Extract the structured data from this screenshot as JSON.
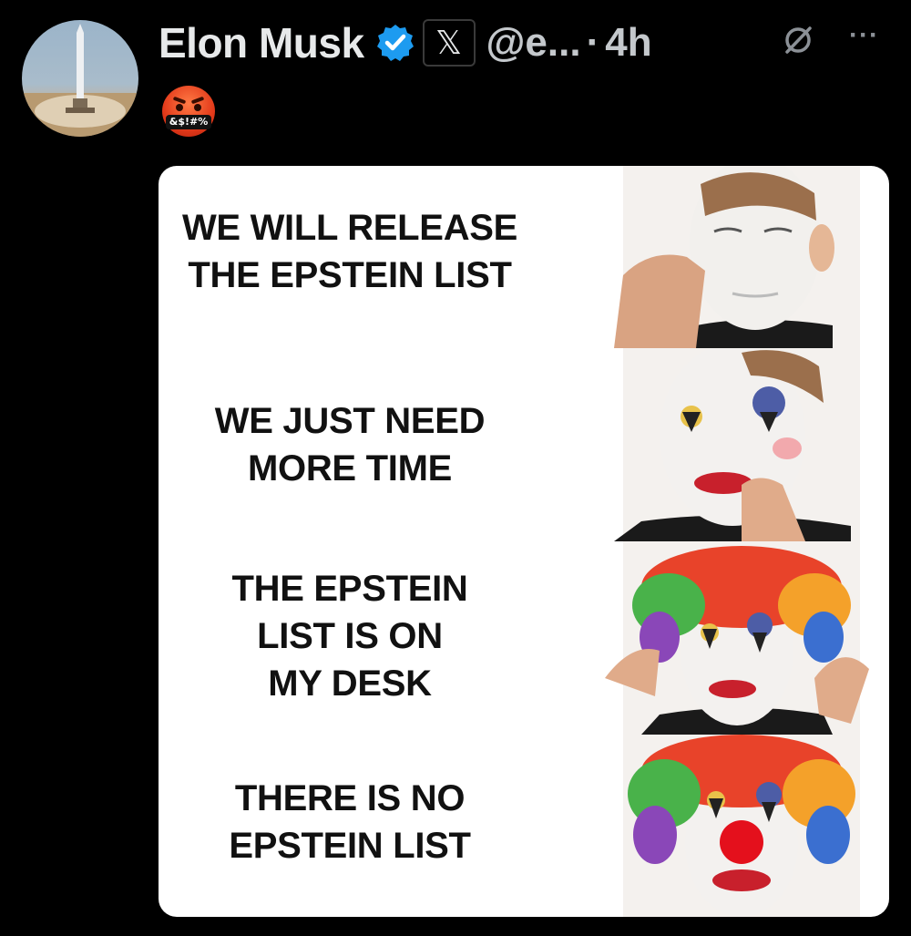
{
  "post": {
    "author_name": "Elon Musk",
    "handle": "@e...",
    "separator": "·",
    "timestamp": "4h",
    "x_badge": "𝕏",
    "more_label": "···",
    "emoji_text": "&$!#%",
    "icons": {
      "avatar": "rocket-launch-avatar",
      "verified": "verified-check-icon",
      "affiliation": "x-logo-icon",
      "grok": "grok-icon",
      "more": "more-options-icon",
      "emoji": "cursing-face-emoji"
    },
    "colors": {
      "verified_blue": "#1d9bf0",
      "background": "#000000",
      "name": "#e7e9ea",
      "meta": "#c4c8cc"
    }
  },
  "meme": {
    "template": "clown-applying-makeup",
    "panels": [
      {
        "line1": "WE WILL RELEASE",
        "line2": "THE EPSTEIN LIST",
        "line3": ""
      },
      {
        "line1": "WE JUST NEED",
        "line2": "MORE TIME",
        "line3": ""
      },
      {
        "line1": "THE EPSTEIN",
        "line2": "LIST IS ON",
        "line3": "MY DESK"
      },
      {
        "line1": "THERE IS NO",
        "line2": "EPSTEIN LIST",
        "line3": ""
      }
    ]
  }
}
